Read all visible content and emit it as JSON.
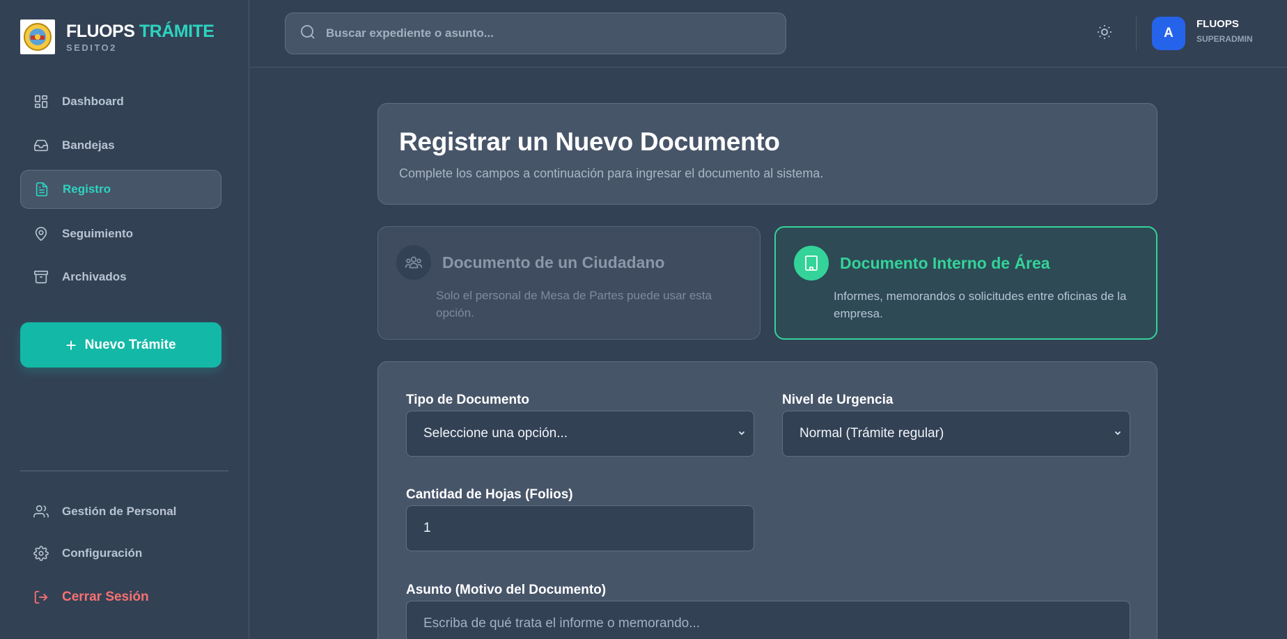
{
  "brand": {
    "title_main": "FLUOPS",
    "title_accent": "TRÁMITE",
    "subtitle": "SEDITO2"
  },
  "sidebar": {
    "items": [
      {
        "label": "Dashboard",
        "icon": "dashboard-icon"
      },
      {
        "label": "Bandejas",
        "icon": "inbox-icon"
      },
      {
        "label": "Registro",
        "icon": "document-icon",
        "active": true
      },
      {
        "label": "Seguimiento",
        "icon": "map-pin-icon"
      },
      {
        "label": "Archivados",
        "icon": "archive-icon"
      }
    ],
    "new_button": "Nuevo Trámite",
    "bottom_items": [
      {
        "label": "Gestión de Personal",
        "icon": "users-icon"
      },
      {
        "label": "Configuración",
        "icon": "gear-icon"
      },
      {
        "label": "Cerrar Sesión",
        "icon": "logout-icon"
      }
    ]
  },
  "header": {
    "search_placeholder": "Buscar expediente o asunto...",
    "avatar_initial": "A",
    "user_name": "FLUOPS",
    "user_role": "SUPERADMIN"
  },
  "hero": {
    "title": "Registrar un Nuevo Documento",
    "subtitle": "Complete los campos a continuación para ingresar el documento al sistema."
  },
  "options": [
    {
      "title": "Documento de un Ciudadano",
      "desc": "Solo el personal de Mesa de Partes puede usar esta opción.",
      "state": "disabled"
    },
    {
      "title": "Documento Interno de Área",
      "desc": "Informes, memorandos o solicitudes entre oficinas de la empresa.",
      "state": "selected"
    }
  ],
  "form": {
    "tipo_label": "Tipo de Documento",
    "tipo_value": "Seleccione una opción...",
    "urgencia_label": "Nivel de Urgencia",
    "urgencia_value": "Normal (Trámite regular)",
    "hojas_label": "Cantidad de Hojas (Folios)",
    "hojas_value": "1",
    "asunto_label": "Asunto (Motivo del Documento)",
    "asunto_placeholder": "Escriba de qué trata el informe o memorando..."
  },
  "colors": {
    "accent": "#14b8a6",
    "accent_text": "#2dd4bf",
    "success": "#34d399",
    "danger": "#f87171",
    "avatar": "#2563eb"
  }
}
